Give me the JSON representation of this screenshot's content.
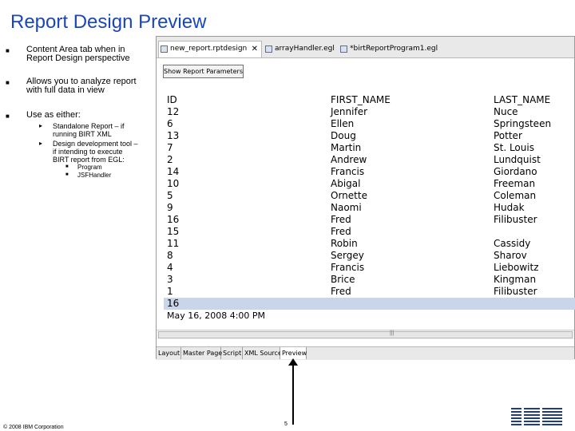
{
  "slide": {
    "title": "Report Design Preview",
    "footer": "© 2008 IBM Corporation",
    "page_number": "5",
    "logo": "IBM"
  },
  "bullets": [
    {
      "text_line1": "Content Area tab when in",
      "text_line2": "Report Design perspective"
    },
    {
      "text_line1": "Allows you to analyze report",
      "text_line2": "with full data in view"
    },
    {
      "text_line1": "Use as either:"
    }
  ],
  "sub_bullets": [
    {
      "line1": "Standalone Report – if",
      "line2": "running BIRT XML"
    },
    {
      "line1": "Design development tool –",
      "line2": "if intending to execute",
      "line3": "BIRT report from EGL:"
    }
  ],
  "sub_sub_bullets": [
    "Program",
    "JSFHandler"
  ],
  "editor": {
    "tabs": [
      {
        "label": "new_report.rptdesign",
        "active": true
      },
      {
        "label": "arrayHandler.egl",
        "active": false
      },
      {
        "label": "*birtReportProgram1.egl",
        "active": false
      }
    ],
    "show_button": "Show Report Parameters",
    "report": {
      "headers": [
        "ID",
        "FIRST_NAME",
        "LAST_NAME"
      ],
      "rows": [
        [
          "12",
          "Jennifer",
          "Nuce"
        ],
        [
          "6",
          "Ellen",
          "Springsteen"
        ],
        [
          "13",
          "Doug",
          "Potter"
        ],
        [
          "7",
          "Martin",
          "St. Louis"
        ],
        [
          "2",
          "Andrew",
          "Lundquist"
        ],
        [
          "14",
          "Francis",
          "Giordano"
        ],
        [
          "10",
          "Abigal",
          "Freeman"
        ],
        [
          "5",
          "Ornette",
          "Coleman"
        ],
        [
          "9",
          "Naomi",
          "Hudak"
        ],
        [
          "16",
          "Fred",
          "Filibuster"
        ],
        [
          "15",
          "Fred",
          ""
        ],
        [
          "11",
          "Robin",
          "Cassidy"
        ],
        [
          "8",
          "Sergey",
          "Sharov"
        ],
        [
          "4",
          "Francis",
          "Liebowitz"
        ],
        [
          "3",
          "Brice",
          "Kingman"
        ],
        [
          "1",
          "Fred",
          "Filibuster"
        ],
        [
          "16",
          "",
          ""
        ]
      ],
      "selected_row_index": 16,
      "timestamp": "May 16, 2008 4:00 PM"
    },
    "bottom_tabs": [
      {
        "label": "Layout",
        "active": false
      },
      {
        "label": "Master Page",
        "active": false
      },
      {
        "label": "Script",
        "active": false
      },
      {
        "label": "XML Source",
        "active": false
      },
      {
        "label": "Preview",
        "active": true
      }
    ]
  },
  "colors": {
    "title": "#1a47b8",
    "selected_row": "#c8d5ea"
  }
}
